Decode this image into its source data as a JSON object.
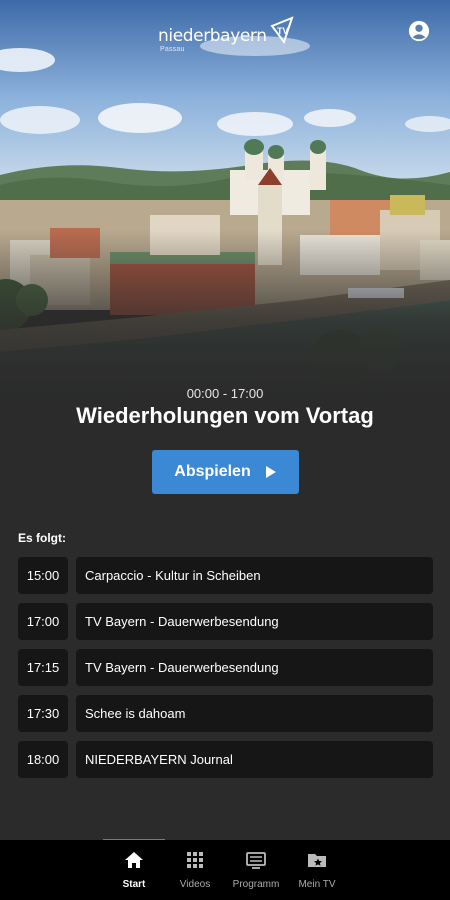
{
  "header": {
    "logo_text": "niederbayern",
    "logo_sub": "Passau",
    "account_icon": "account-circle-icon"
  },
  "now": {
    "time_range": "00:00 - 17:00",
    "title": "Wiederholungen vom Vortag",
    "play_label": "Abspielen"
  },
  "next": {
    "label": "Es folgt:",
    "items": [
      {
        "time": "15:00",
        "title": "Carpaccio - Kultur in Scheiben"
      },
      {
        "time": "17:00",
        "title": "TV Bayern - Dauerwerbesendung"
      },
      {
        "time": "17:15",
        "title": "TV Bayern - Dauerwerbesendung"
      },
      {
        "time": "17:30",
        "title": "Schee is dahoam"
      },
      {
        "time": "18:00",
        "title": "NIEDERBAYERN Journal"
      }
    ]
  },
  "nav": {
    "items": [
      {
        "label": "Start",
        "icon": "home-icon",
        "active": true
      },
      {
        "label": "Videos",
        "icon": "grid-icon",
        "active": false
      },
      {
        "label": "Programm",
        "icon": "tv-guide-icon",
        "active": false
      },
      {
        "label": "Mein TV",
        "icon": "folder-star-icon",
        "active": false
      }
    ]
  },
  "colors": {
    "accent": "#3b88d4",
    "background": "#2b2b2b",
    "row_background": "#161616",
    "nav_background": "#000000"
  }
}
